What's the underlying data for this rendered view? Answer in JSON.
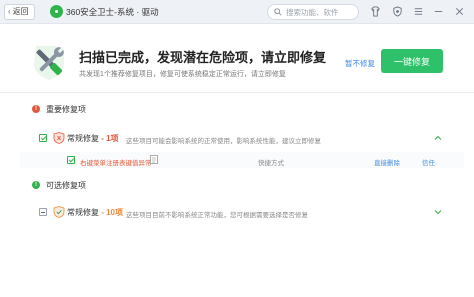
{
  "titlebar": {
    "back_label": "返回",
    "app_title": "360安全卫士-系统 · 驱动",
    "search_placeholder": "搜索功能、软件"
  },
  "header": {
    "title": "扫描已完成，发现潜在危险项，请立即修复",
    "subtitle": "共发现1个推荐修复项目，修复可使系统稳定正常运行，请立即修复",
    "later_link": "暂不修复",
    "fix_all_button": "一键修复"
  },
  "sections": {
    "important": {
      "title": "重要修复项",
      "group": {
        "name": "常规修复",
        "count": " - 1项",
        "desc": "这些项目可能会影响系统的正常使用，影响系统性能，建议立即修复"
      },
      "item": {
        "name": "右键菜单注册表键值异常",
        "status": "快捷方式",
        "action_fix": "直接删除",
        "action_trust": "信任"
      }
    },
    "optional": {
      "title": "可选修复项",
      "group": {
        "name": "常规修复",
        "count": " - 10项",
        "desc": "这些项目目前不影响系统正常功能，您可根据需要选择是否修复"
      }
    }
  },
  "colors": {
    "accent_green": "#2fc06a",
    "danger_red": "#e4573a",
    "link_blue": "#3d8ae0"
  }
}
